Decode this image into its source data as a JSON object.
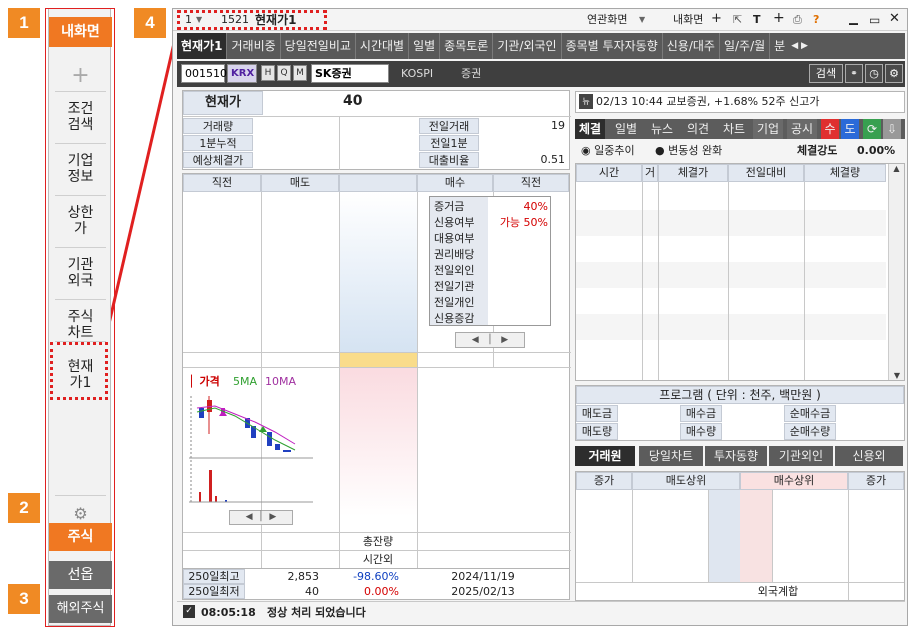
{
  "badges": [
    "1",
    "2",
    "3",
    "4"
  ],
  "sidebar": {
    "top_label": "내화면",
    "plus": "+",
    "items": [
      {
        "line1": "조건",
        "line2": "검색"
      },
      {
        "line1": "기업",
        "line2": "정보"
      },
      {
        "line1": "상한",
        "line2": "가"
      },
      {
        "line1": "기관",
        "line2": "외국"
      },
      {
        "line1": "주식",
        "line2": "차트"
      },
      {
        "line1": "현재",
        "line2": "가1"
      }
    ],
    "gear": "⚙",
    "bottom": [
      "주식",
      "선옵",
      "해외주식"
    ]
  },
  "titlebar": {
    "window_num": "1",
    "screen_no": "1521",
    "screen_name": "현재가1",
    "related": "연관화면",
    "my_screen": "내화면",
    "plus": "+",
    "icons": [
      "T",
      "+",
      "?"
    ]
  },
  "tabs": [
    "현재가1",
    "거래비중",
    "당일전일비교",
    "시간대별",
    "일별",
    "종목토론",
    "기관/외국인",
    "종목별 투자자동향",
    "신용/대주",
    "일/주/월",
    "분"
  ],
  "toolbar": {
    "code": "001510",
    "market": "KRX",
    "btn_h": "H",
    "btn_q": "Q",
    "btn_m": "M",
    "stock_name": "SK증권",
    "exchange": "KOSPI",
    "sector": "증권",
    "search": "검색"
  },
  "price": {
    "label": "현재가",
    "value": "40",
    "rows": [
      {
        "label": "거래량",
        "value": "",
        "label2": "전일거래",
        "value2": "19"
      },
      {
        "label": "1분누적",
        "value": "",
        "label2": "전일1분",
        "value2": ""
      },
      {
        "label": "예상체결가",
        "value": "",
        "label2": "대출비율",
        "value2": "0.51"
      }
    ]
  },
  "orderbook": {
    "headers": [
      "직전",
      "매도",
      "",
      "매수",
      "직전"
    ],
    "info": [
      {
        "label": "증거금",
        "value": "40%"
      },
      {
        "label": "신용여부",
        "value": "가능 50%"
      },
      {
        "label": "대용여부",
        "value": ""
      },
      {
        "label": "권리배당",
        "value": ""
      },
      {
        "label": "전일외인",
        "value": ""
      },
      {
        "label": "전일기관",
        "value": ""
      },
      {
        "label": "전일개인",
        "value": ""
      },
      {
        "label": "신용증감",
        "value": ""
      }
    ],
    "total_remain": "총잔량",
    "after_hours": "시간외"
  },
  "mini_chart": {
    "legend_price": "가격",
    "legend_5ma": "5MA",
    "legend_10ma": "10MA"
  },
  "stats": [
    {
      "label": "250일최고",
      "value": "2,853",
      "pct": "-98.60%",
      "date": "2024/11/19"
    },
    {
      "label": "250일최저",
      "value": "40",
      "pct": "0.00%",
      "date": "2025/02/13"
    }
  ],
  "news": {
    "icon": "뉴",
    "text": "02/13 10:44 교보증권, +1.68% 52주 신고가"
  },
  "right_tabs": [
    "체결",
    "일별",
    "뉴스",
    "의견",
    "차트",
    "기업",
    "공시"
  ],
  "right_tab_extra": [
    "수",
    "도"
  ],
  "trade_opts": {
    "opt1": "일중추이",
    "opt2": "변동성 완화",
    "strength_label": "체결강도",
    "strength_value": "0.00%"
  },
  "trade_headers": [
    "시간",
    "거",
    "체결가",
    "전일대비",
    "체결량"
  ],
  "program": {
    "title": "프로그램 ( 단위 : 천주, 백만원 )",
    "rows": [
      [
        "매도금",
        "매수금",
        "순매수금"
      ],
      [
        "매도량",
        "매수량",
        "순매수량"
      ]
    ]
  },
  "bottom_tabs": [
    "거래원",
    "당일차트",
    "투자동향",
    "기관외인",
    "신용외"
  ],
  "broker_headers": [
    "증가",
    "매도상위",
    "",
    "매수상위",
    "증가"
  ],
  "foreign_total": "외국계합",
  "status": {
    "time": "08:05:18",
    "message": "정상 처리 되었습니다"
  },
  "colors": {
    "accent_orange": "#f07822",
    "badge_orange": "#f08a24",
    "highlight_red": "#e02020",
    "tab_dark": "#2d2d2d"
  }
}
